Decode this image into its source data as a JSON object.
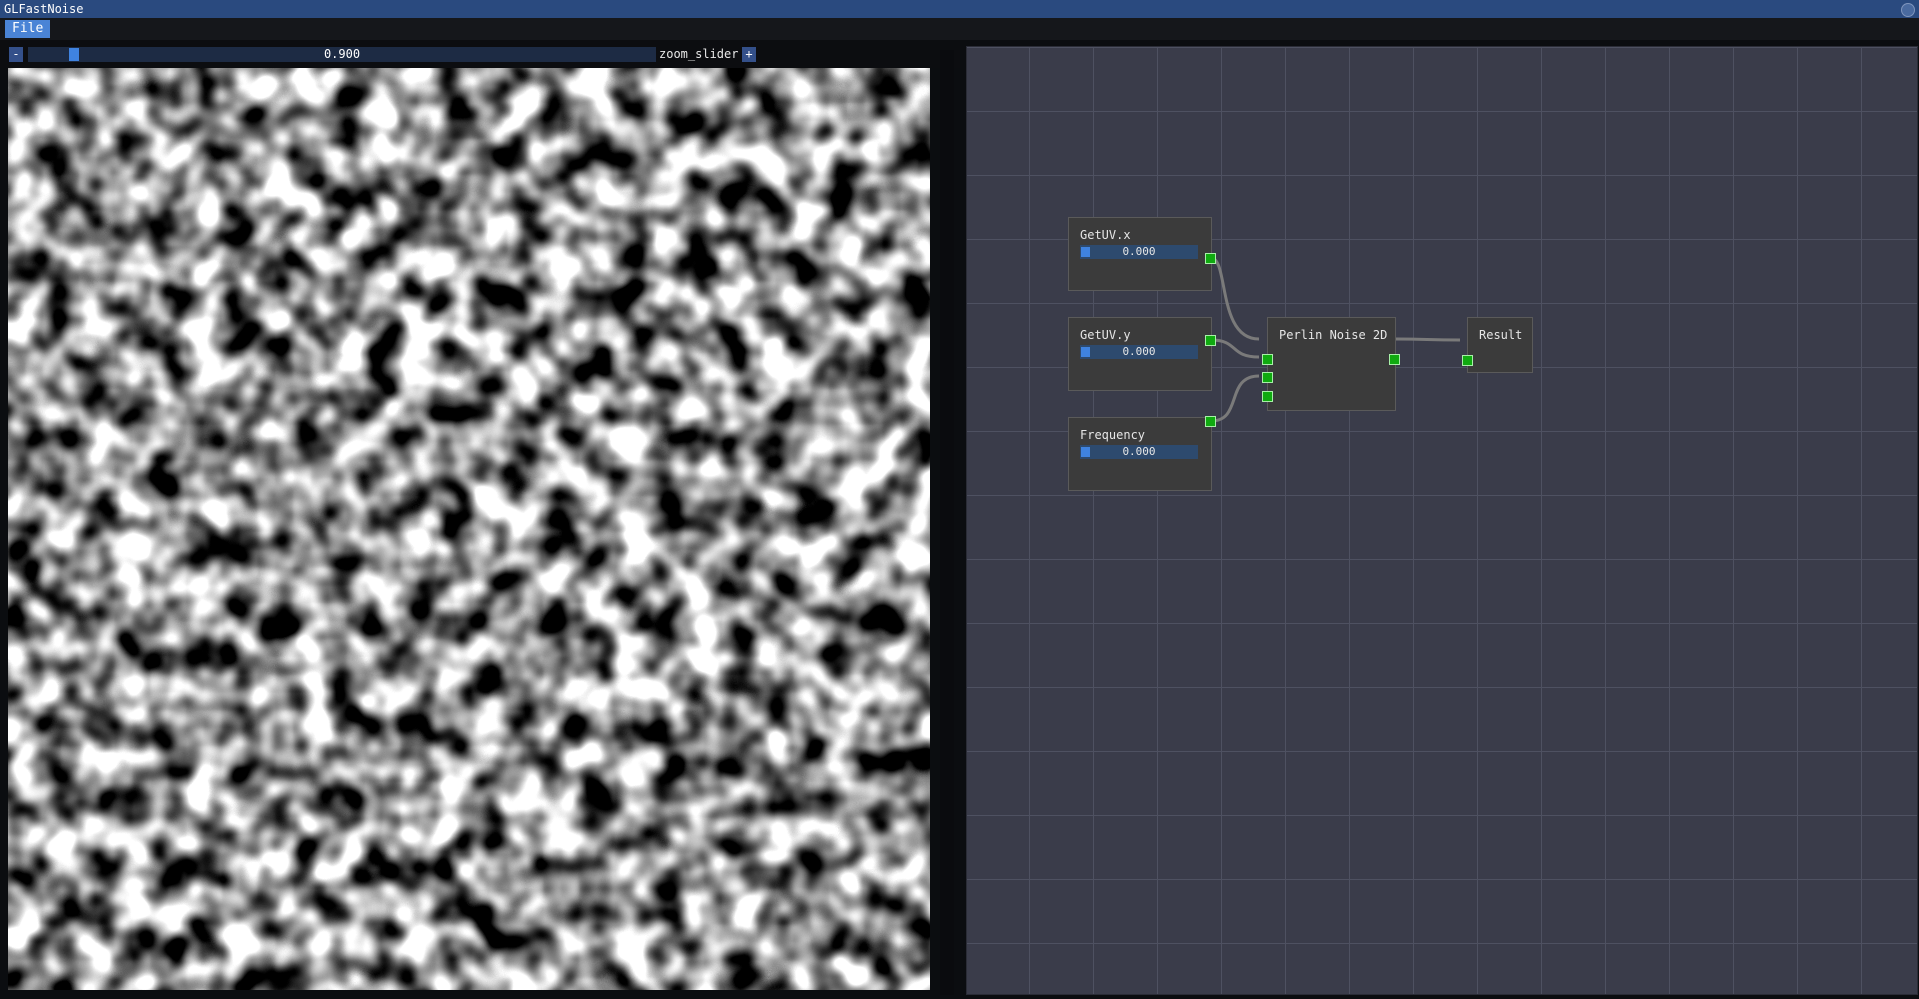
{
  "window": {
    "title": "GLFastNoise"
  },
  "menu": {
    "file_label": "File"
  },
  "toolbar": {
    "minus_label": "-",
    "plus_label": "+",
    "zoom_value": "0.900",
    "zoom_fraction": 0.03,
    "zoom_label": "zoom_slider"
  },
  "preview": {
    "description_icon": "noise-image-icon"
  },
  "graph": {
    "nodes": {
      "getuv_x": {
        "title": "GetUV.x",
        "value": "0.000"
      },
      "getuv_y": {
        "title": "GetUV.y",
        "value": "0.000"
      },
      "frequency": {
        "title": "Frequency",
        "value": "0.000"
      },
      "perlin": {
        "title": "Perlin Noise 2D"
      },
      "result": {
        "title": "Result"
      }
    },
    "colors": {
      "background": "#3a3c4a",
      "grid": "#4e5161",
      "node": "#3b3b3b",
      "port": "#10aa10",
      "wire": "#7a7a7a",
      "accent": "#3f83e0"
    }
  }
}
